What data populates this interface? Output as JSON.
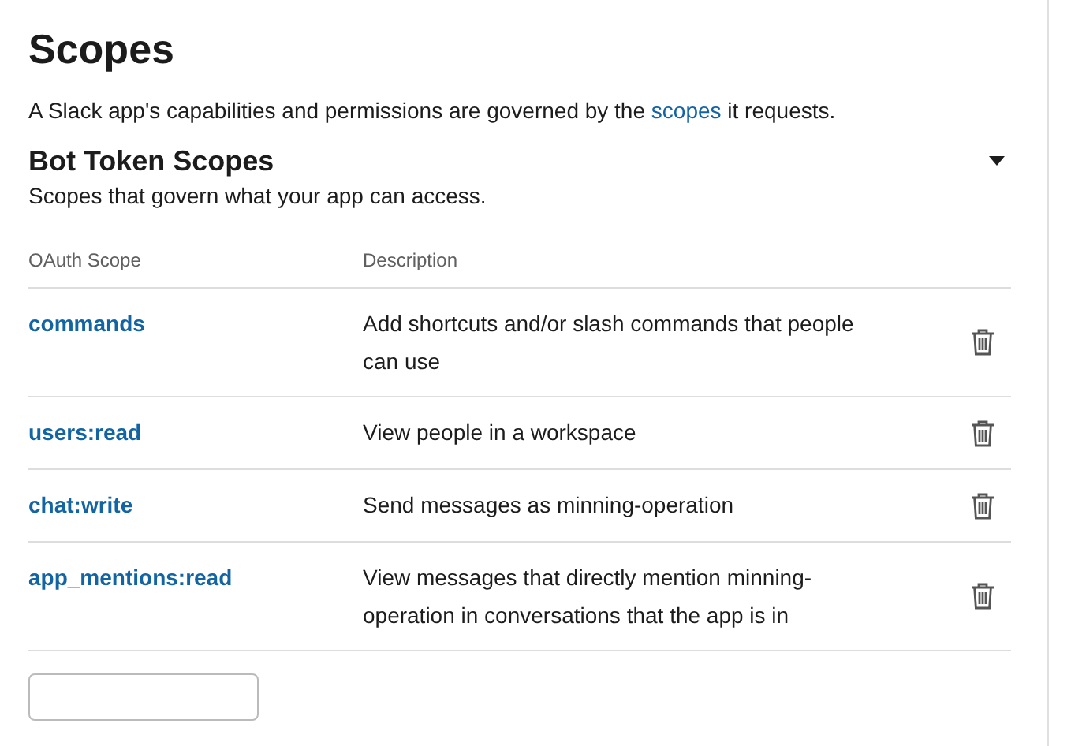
{
  "title": "Scopes",
  "intro": {
    "before": "A Slack app's capabilities and permissions are governed by the ",
    "link": "scopes",
    "after": " it requests."
  },
  "section": {
    "title": "Bot Token Scopes",
    "subtitle": "Scopes that govern what your app can access.",
    "expanded": true
  },
  "table": {
    "columns": [
      "OAuth Scope",
      "Description"
    ],
    "rows": [
      {
        "scope": "commands",
        "description": "Add shortcuts and/or slash commands that people can use"
      },
      {
        "scope": "users:read",
        "description": "View people in a workspace"
      },
      {
        "scope": "chat:write",
        "description": "Send messages as minning-operation"
      },
      {
        "scope": "app_mentions:read",
        "description": "View messages that directly mention minning-operation in conversations that the app is in"
      }
    ]
  }
}
